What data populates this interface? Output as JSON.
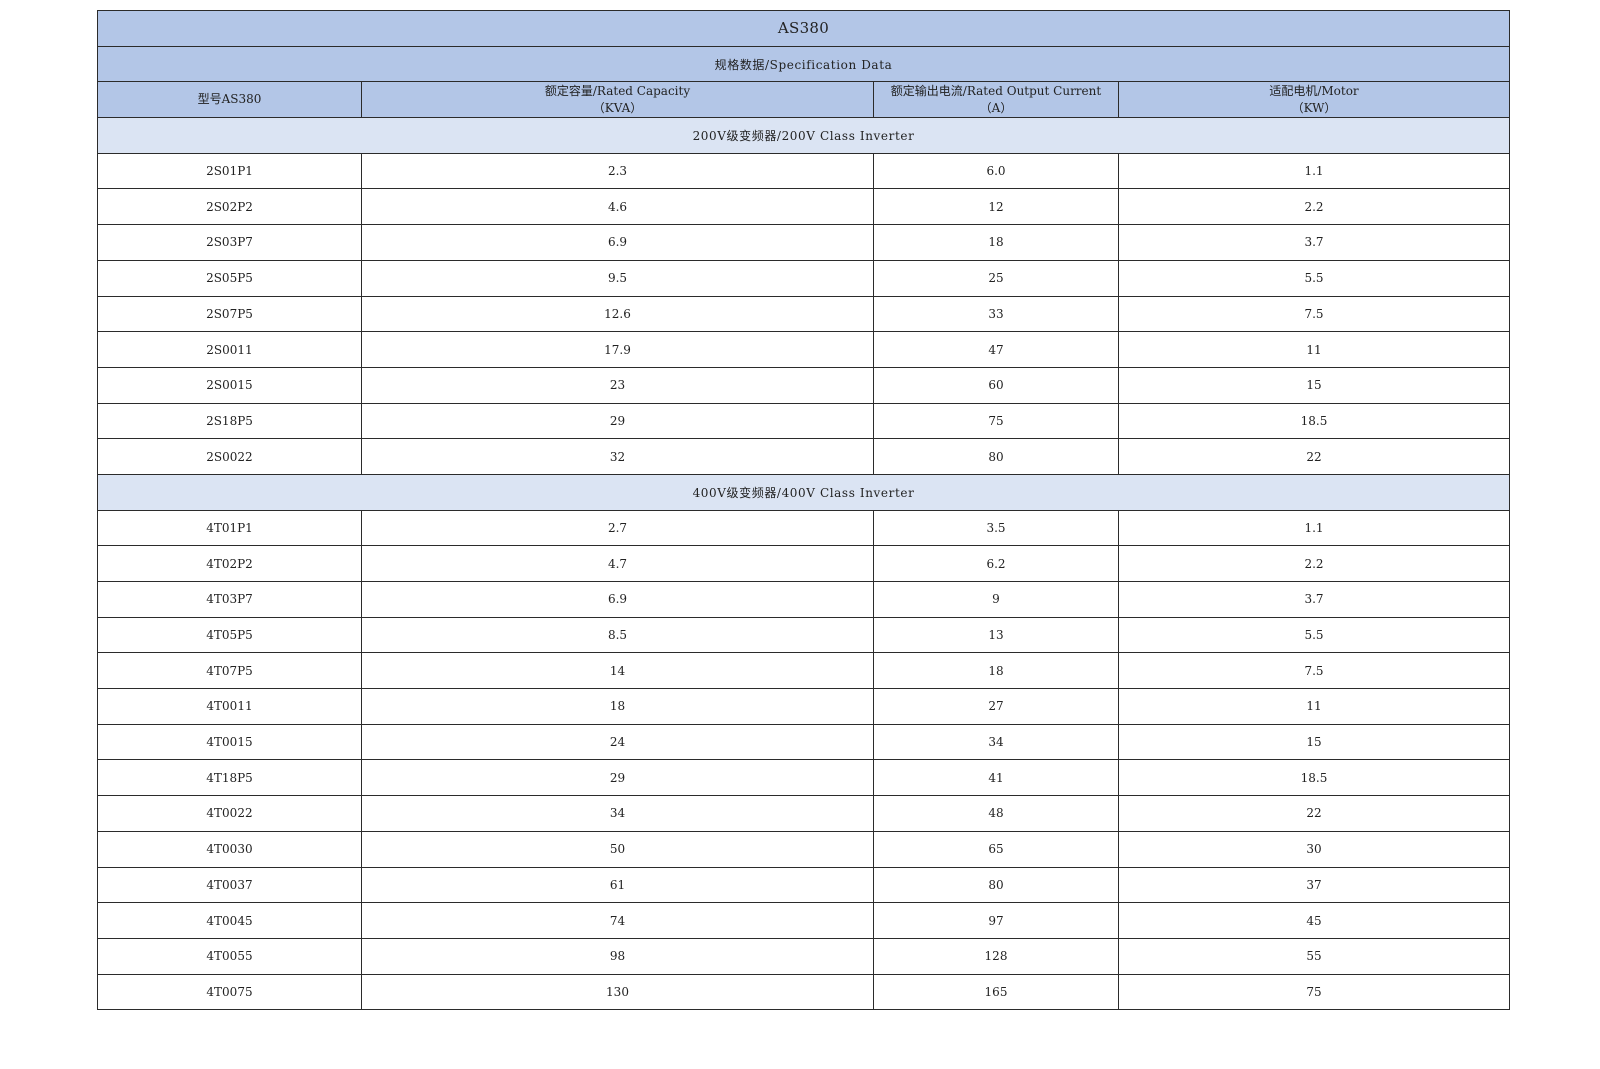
{
  "table": {
    "title": "AS380",
    "subtitle": "规格数据/Specification Data",
    "headers": {
      "model": "型号AS380",
      "capacity_line1": "额定容量/Rated Capacity",
      "capacity_line2": "（KVA）",
      "current_line1": "额定输出电流/Rated Output Current",
      "current_line2": "（A）",
      "motor_line1": "适配电机/Motor",
      "motor_line2": "（KW）"
    },
    "groups": [
      {
        "label": "200V级变频器/200V Class Inverter",
        "rows": [
          {
            "model": "2S01P1",
            "capacity": "2.3",
            "current": "6.0",
            "motor": "1.1"
          },
          {
            "model": "2S02P2",
            "capacity": "4.6",
            "current": "12",
            "motor": "2.2"
          },
          {
            "model": "2S03P7",
            "capacity": "6.9",
            "current": "18",
            "motor": "3.7"
          },
          {
            "model": "2S05P5",
            "capacity": "9.5",
            "current": "25",
            "motor": "5.5"
          },
          {
            "model": "2S07P5",
            "capacity": "12.6",
            "current": "33",
            "motor": "7.5"
          },
          {
            "model": "2S0011",
            "capacity": "17.9",
            "current": "47",
            "motor": "11"
          },
          {
            "model": "2S0015",
            "capacity": "23",
            "current": "60",
            "motor": "15"
          },
          {
            "model": "2S18P5",
            "capacity": "29",
            "current": "75",
            "motor": "18.5"
          },
          {
            "model": "2S0022",
            "capacity": "32",
            "current": "80",
            "motor": "22"
          }
        ]
      },
      {
        "label": "400V级变频器/400V Class Inverter",
        "rows": [
          {
            "model": "4T01P1",
            "capacity": "2.7",
            "current": "3.5",
            "motor": "1.1"
          },
          {
            "model": "4T02P2",
            "capacity": "4.7",
            "current": "6.2",
            "motor": "2.2"
          },
          {
            "model": "4T03P7",
            "capacity": "6.9",
            "current": "9",
            "motor": "3.7"
          },
          {
            "model": "4T05P5",
            "capacity": "8.5",
            "current": "13",
            "motor": "5.5"
          },
          {
            "model": "4T07P5",
            "capacity": "14",
            "current": "18",
            "motor": "7.5"
          },
          {
            "model": "4T0011",
            "capacity": "18",
            "current": "27",
            "motor": "11"
          },
          {
            "model": "4T0015",
            "capacity": "24",
            "current": "34",
            "motor": "15"
          },
          {
            "model": "4T18P5",
            "capacity": "29",
            "current": "41",
            "motor": "18.5"
          },
          {
            "model": "4T0022",
            "capacity": "34",
            "current": "48",
            "motor": "22"
          },
          {
            "model": "4T0030",
            "capacity": "50",
            "current": "65",
            "motor": "30"
          },
          {
            "model": "4T0037",
            "capacity": "61",
            "current": "80",
            "motor": "37"
          },
          {
            "model": "4T0045",
            "capacity": "74",
            "current": "97",
            "motor": "45"
          },
          {
            "model": "4T0055",
            "capacity": "98",
            "current": "128",
            "motor": "55"
          },
          {
            "model": "4T0075",
            "capacity": "130",
            "current": "165",
            "motor": "75"
          }
        ]
      }
    ],
    "colors": {
      "header_bg": "#b3c6e7",
      "group_bg": "#dbe4f3",
      "grid_line": "#2b2b2b"
    }
  }
}
